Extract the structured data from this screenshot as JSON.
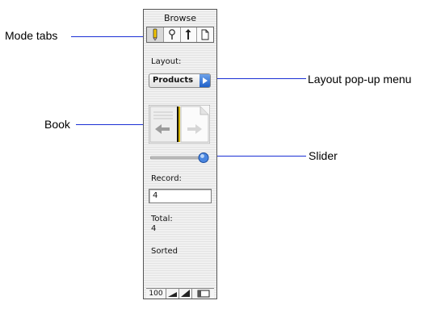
{
  "callouts": {
    "mode_tabs": "Mode tabs",
    "layout_popup": "Layout pop-up menu",
    "book": "Book",
    "slider": "Slider"
  },
  "status_area": {
    "mode_title": "Browse",
    "tabs": [
      {
        "icon": "pencil-icon",
        "mode": "browse",
        "active": true
      },
      {
        "icon": "magnifier-icon",
        "mode": "find",
        "active": false
      },
      {
        "icon": "tool-icon",
        "mode": "layout",
        "active": false
      },
      {
        "icon": "page-icon",
        "mode": "preview",
        "active": false
      }
    ],
    "layout_label": "Layout:",
    "layout_value": "Products",
    "record_label": "Record:",
    "record_value": "4",
    "total_label": "Total:",
    "total_value": "4",
    "sort_status": "Sorted",
    "zoom_level": "100",
    "slider_position": 1.0
  },
  "colors": {
    "leader": "#1a2fd4",
    "accent": "#2a66d0"
  }
}
